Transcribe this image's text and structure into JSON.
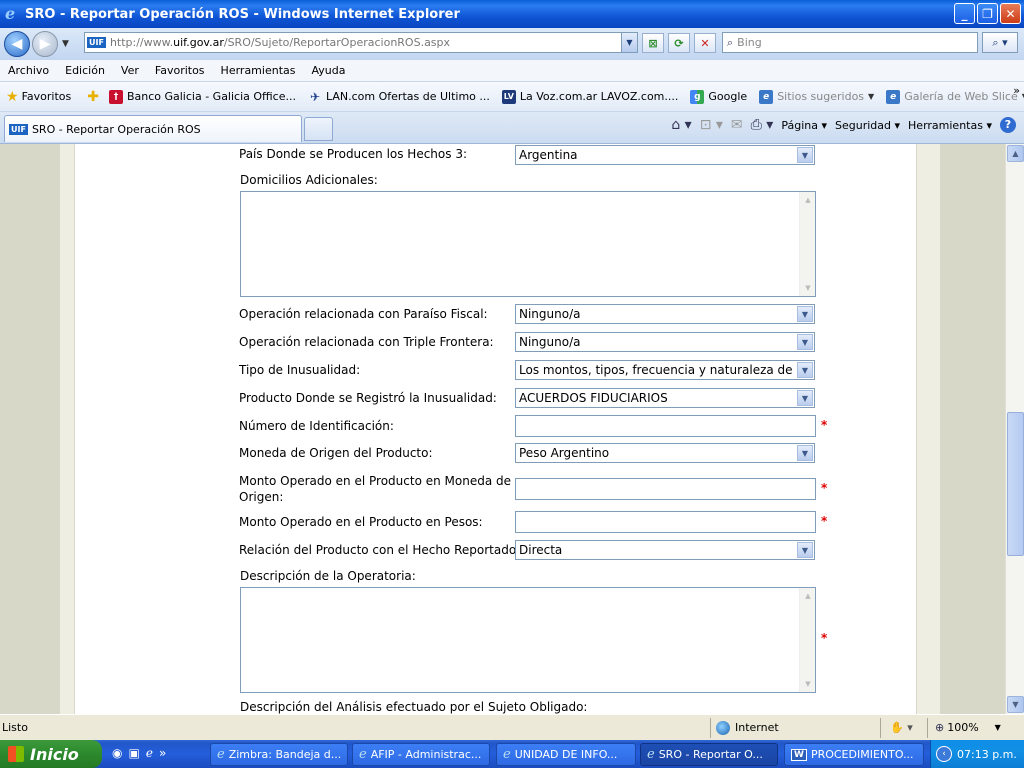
{
  "window": {
    "title": "SRO - Reportar Operación ROS - Windows Internet Explorer",
    "minimize": "_",
    "restore": "❐",
    "close": "✕"
  },
  "address": {
    "favicon_text": "UIF",
    "url_prefix": "http://www.",
    "url_domain": "uif.gov.ar",
    "url_path": "/SRO/Sujeto/ReportarOperacionROS.aspx",
    "search_placeholder": "Bing"
  },
  "menu": [
    "Archivo",
    "Edición",
    "Ver",
    "Favoritos",
    "Herramientas",
    "Ayuda"
  ],
  "favorites_bar": {
    "favorites_label": "Favoritos",
    "items": [
      {
        "label": "Banco Galicia - Galicia Office...",
        "icon_color": "#c8102e",
        "icon_glyph": "†",
        "gray": false
      },
      {
        "label": "LAN.com Ofertas de Ultimo ...",
        "icon_color": "#1c3a8a",
        "icon_glyph": "✈",
        "gray": false
      },
      {
        "label": "La Voz.com.ar  LAVOZ.com....",
        "icon_color": "#1e3a7a",
        "icon_glyph": "LV",
        "gray": false
      },
      {
        "label": "Google",
        "icon_color": "#2f8fe5",
        "icon_glyph": "g",
        "gray": false
      },
      {
        "label": "Sitios sugeridos",
        "icon_color": "#3b78c8",
        "icon_glyph": "e",
        "gray": true,
        "dropdown": true
      },
      {
        "label": "Galería de Web Slice",
        "icon_color": "#3b78c8",
        "icon_glyph": "e",
        "gray": true,
        "dropdown": true
      }
    ]
  },
  "tab": {
    "favicon_text": "UIF",
    "label": "SRO - Reportar Operación ROS"
  },
  "commandbar": {
    "page": "Página",
    "safety": "Seguridad",
    "tools": "Herramientas"
  },
  "form": {
    "pais_label": "País Donde se Producen los Hechos 3:",
    "pais_value": "Argentina",
    "domicilios_label": "Domicilios Adicionales:",
    "paraiso_label": "Operación relacionada con Paraíso Fiscal:",
    "paraiso_value": "Ninguno/a",
    "triple_label": "Operación relacionada con Triple Frontera:",
    "triple_value": "Ninguno/a",
    "tipo_label": "Tipo de Inusualidad:",
    "tipo_value": "Los montos, tipos, frecuencia y naturaleza de la",
    "producto_label": "Producto Donde se Registró la Inusualidad:",
    "producto_value": "ACUERDOS FIDUCIARIOS",
    "numero_label": "Número de Identificación:",
    "moneda_label": "Moneda de Origen del Producto:",
    "moneda_value": "Peso Argentino",
    "monto_origen_label_1": "Monto Operado en el Producto en Moneda de",
    "monto_origen_label_2": "Origen:",
    "monto_pesos_label": "Monto Operado en el Producto en Pesos:",
    "relacion_label": "Relación del Producto con el Hecho Reportado:",
    "relacion_value": "Directa",
    "descripcion_label": "Descripción de la Operatoria:",
    "analisis_label": "Descripción del Análisis efectuado por el Sujeto Obligado:",
    "required_mark": "*"
  },
  "status": {
    "text": "Listo",
    "zone": "Internet",
    "zoom": "100%"
  },
  "taskbar": {
    "start": "Inicio",
    "tasks": [
      {
        "label": "Zimbra: Bandeja d...",
        "icon": "e",
        "active": false
      },
      {
        "label": "AFIP - Administrac...",
        "icon": "e",
        "active": false
      },
      {
        "label": "UNIDAD DE INFO...",
        "icon": "e",
        "active": false
      },
      {
        "label": "SRO - Reportar O...",
        "icon": "e",
        "active": true
      },
      {
        "label": "PROCEDIMIENTO...",
        "icon": "W",
        "active": false
      }
    ],
    "clock": "07:13 p.m."
  }
}
